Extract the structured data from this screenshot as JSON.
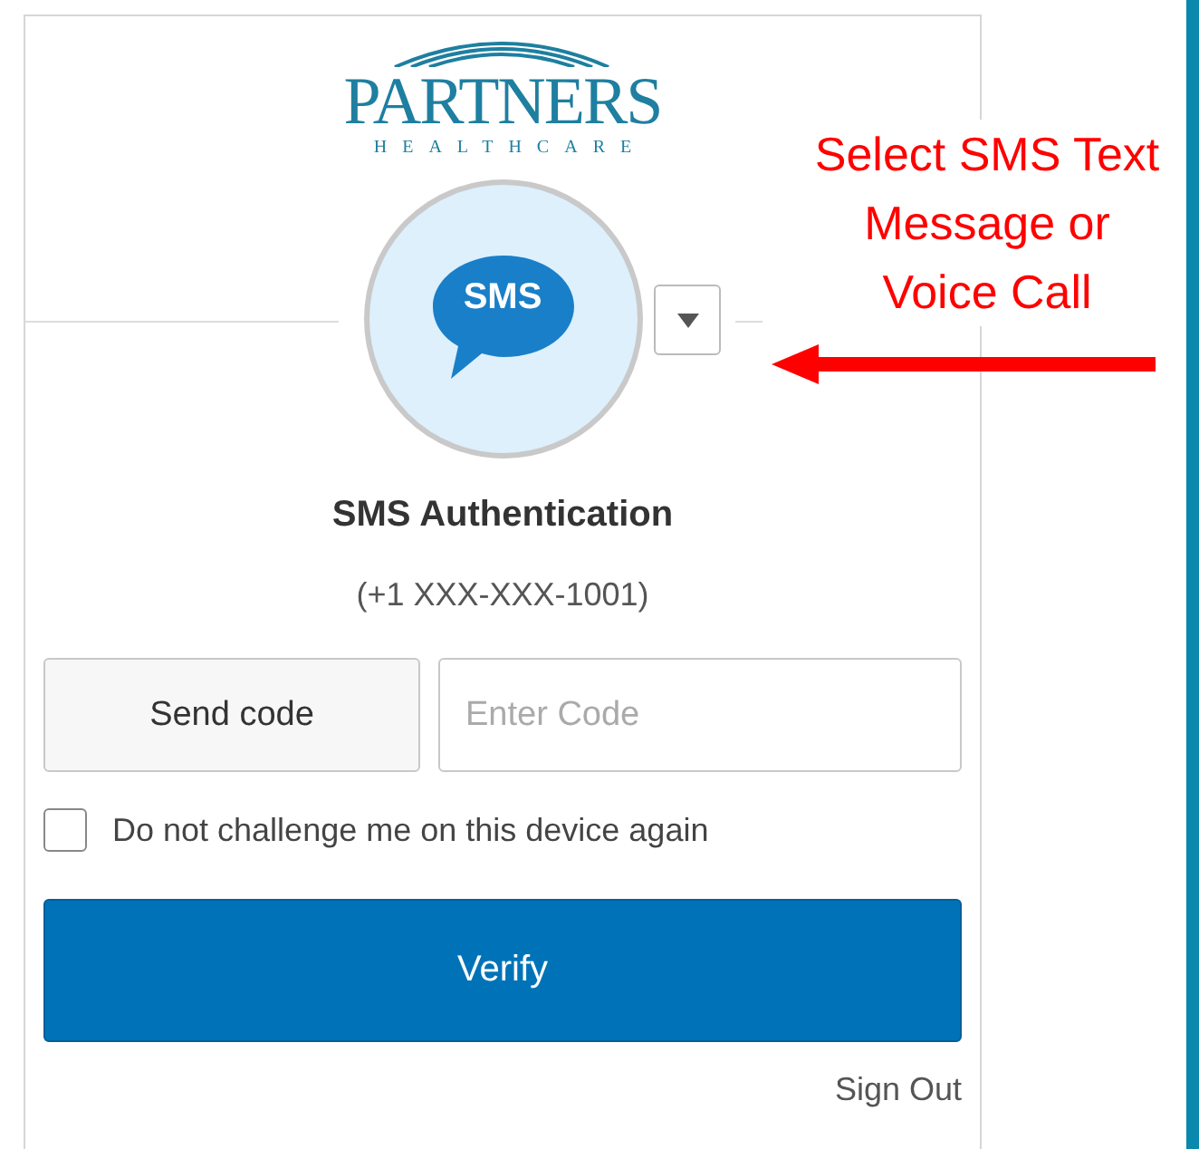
{
  "logo": {
    "name": "PARTNERS",
    "subtitle": "HEALTHCARE"
  },
  "method": {
    "icon_label": "SMS",
    "title": "SMS Authentication",
    "phone": "(+1 XXX-XXX-1001)"
  },
  "send_button": {
    "label": "Send code"
  },
  "code_field": {
    "placeholder": "Enter Code"
  },
  "remember": {
    "label": "Do not challenge me on this device again",
    "checked": false
  },
  "verify_button": {
    "label": "Verify"
  },
  "sign_out": {
    "label": "Sign Out"
  },
  "annotation": {
    "lines": [
      "Select SMS Text",
      "Message or",
      "Voice Call"
    ]
  }
}
